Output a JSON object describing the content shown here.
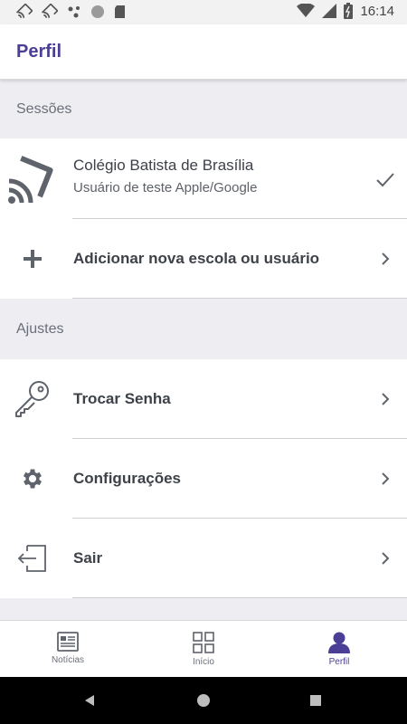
{
  "status_bar": {
    "time": "16:14",
    "icons": [
      "cast-icon",
      "cast-icon",
      "dots-icon",
      "circle-icon",
      "sd-card-icon",
      "wifi-icon",
      "signal-icon",
      "battery-icon"
    ]
  },
  "header": {
    "title": "Perfil"
  },
  "sections": {
    "sessions": {
      "label": "Sessões"
    },
    "settings": {
      "label": "Ajustes"
    }
  },
  "session": {
    "school_name": "Colégio Batista de Brasília",
    "user_name": "Usuário de teste Apple/Google",
    "add_label": "Adicionar nova escola ou usuário"
  },
  "settings_items": {
    "change_password": "Trocar Senha",
    "configurations": "Configurações",
    "logout": "Sair"
  },
  "bottom_nav": {
    "news": "Notícias",
    "home": "Início",
    "profile": "Perfil"
  },
  "colors": {
    "accent": "#4a3e96",
    "section_bg": "#ededf2",
    "icon_gray": "#5f636b"
  }
}
